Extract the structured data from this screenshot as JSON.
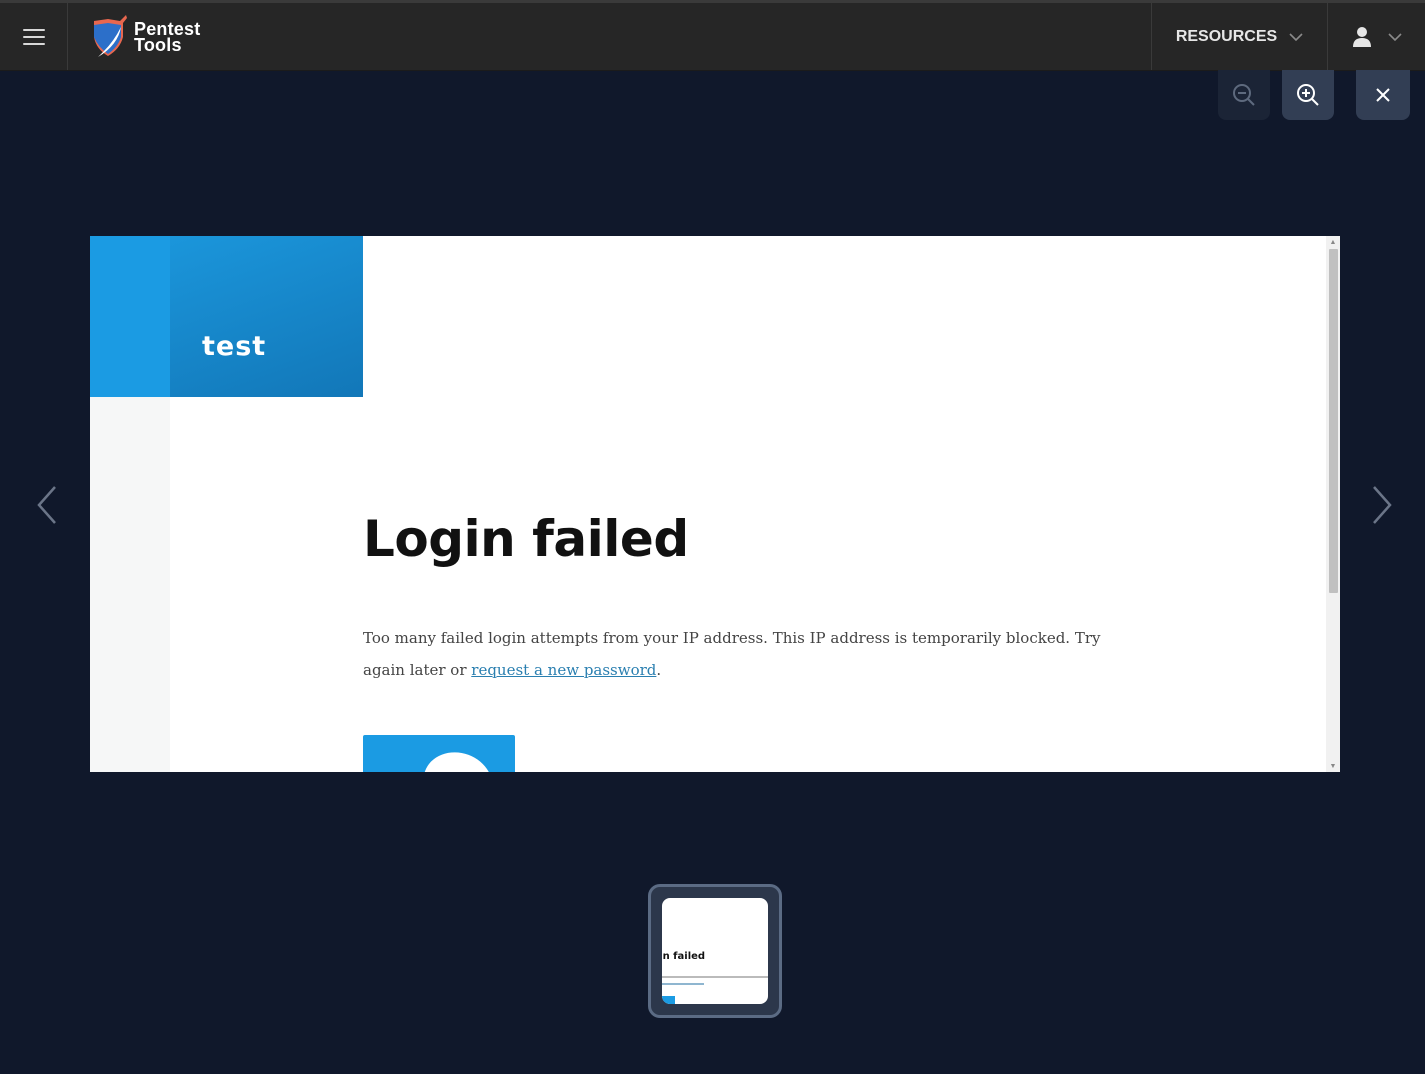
{
  "topbar": {
    "menu_icon": "hamburger-icon",
    "logo": {
      "line1": "Pentest",
      "line2": "Tools",
      "icon": "shield-logo-icon"
    },
    "resources_label": "RESOURCES",
    "resources_icon": "chevron-down-icon",
    "user_icon": "user-icon",
    "user_chevron_icon": "chevron-down-icon"
  },
  "viewer_toolbar": {
    "zoom_out_icon": "zoom-out-icon",
    "zoom_in_icon": "zoom-in-icon",
    "close_icon": "close-icon"
  },
  "screenshot": {
    "site_name": "test",
    "title": "Login failed",
    "message_before_link": "Too many failed login attempts from your IP address. This IP address is temporarily blocked. Try again later or ",
    "link_text": "request a new password",
    "message_after_link": ".",
    "colors": {
      "brand_blue": "#1b9be3",
      "link": "#2a7fb0"
    }
  },
  "navigation": {
    "prev_icon": "chevron-left-icon",
    "next_icon": "chevron-right-icon"
  },
  "thumbnails": [
    {
      "title": "gin failed",
      "selected": true
    }
  ]
}
